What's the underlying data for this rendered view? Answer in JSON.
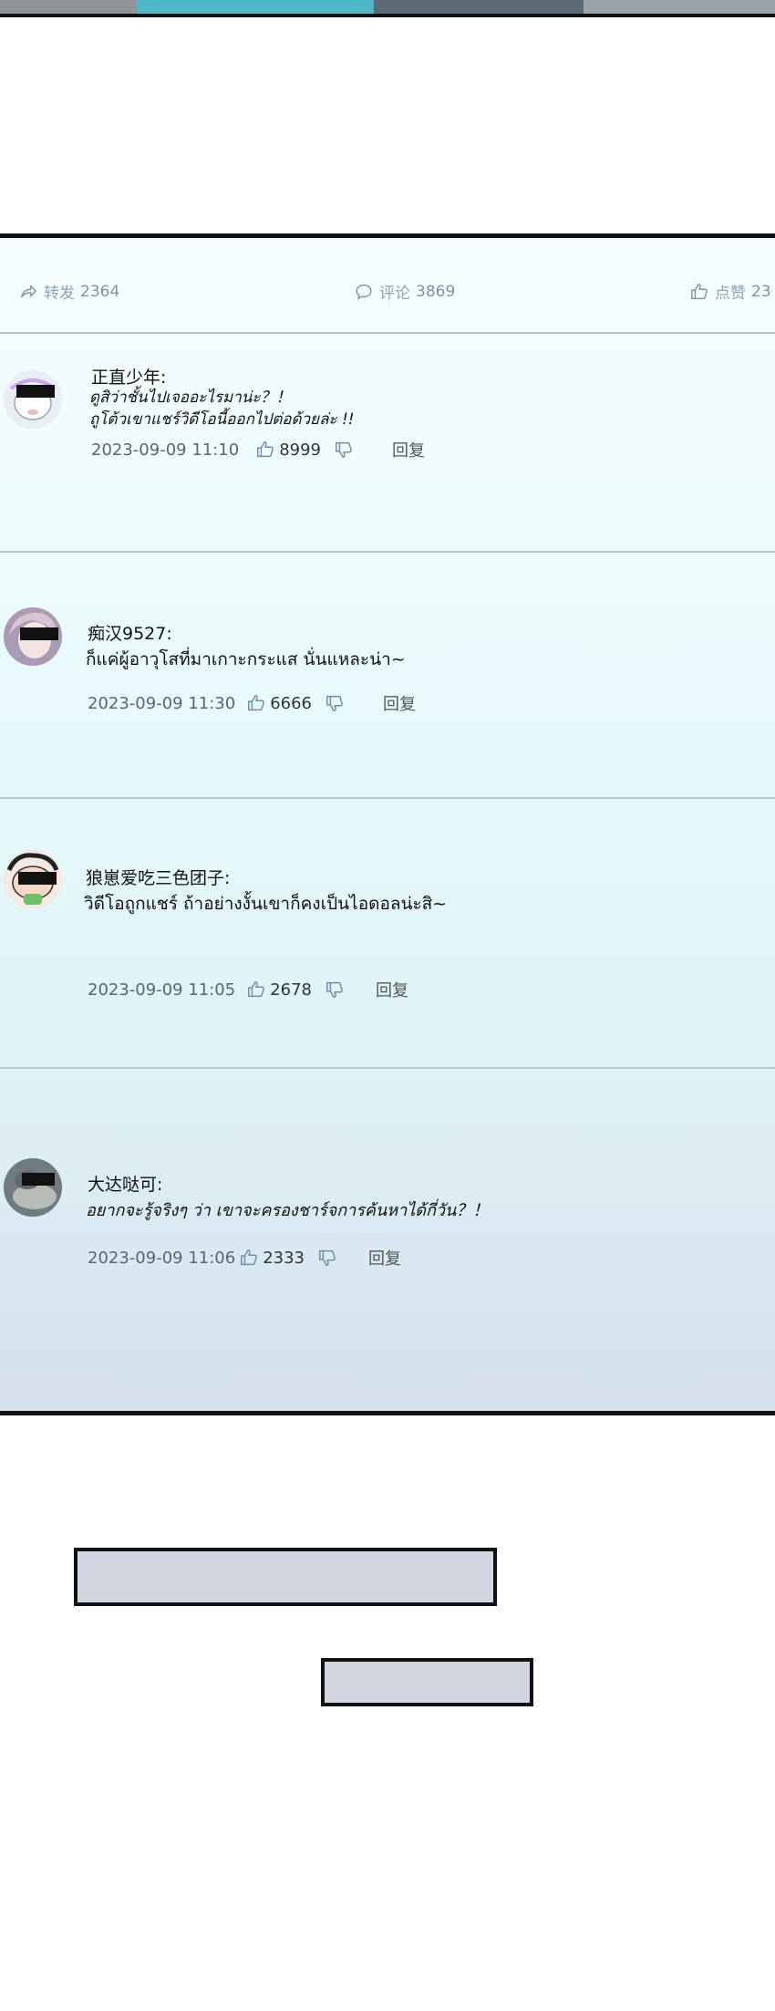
{
  "stats": {
    "share_label": "转发",
    "share_count": "2364",
    "comment_label": "评论",
    "comment_count": "3869",
    "like_label": "点赞",
    "like_count": "23"
  },
  "comments": [
    {
      "name": "正直少年:",
      "line1": "ดูสิว่าชั้นไปเจออะไรมาน่ะ？！",
      "line2": "ถูโต้วเขาแชร์วิดีโอนี้ออกไปต่อด้วยล่ะ !!",
      "date": "2023-09-09 11:10",
      "likes": "8999",
      "reply": "回复",
      "avatar_color": "#dde3ec"
    },
    {
      "name": "痴汉9527:",
      "line1": "ก็แค่ผู้อาวุโสที่มาเกาะกระแส นั่นแหละน่า~",
      "line2": "",
      "date": "2023-09-09   11:30",
      "likes": "6666",
      "reply": "回复",
      "avatar_color": "#b8a9c4"
    },
    {
      "name": "狼崽爱吃三色团子:",
      "line1": "วิดีโอถูกแชร์ ถ้าอย่างงั้นเขาก็คงเป็นไอดอลน่ะสิ~",
      "line2": "",
      "date": "2023-09-09   11:05",
      "likes": "2678",
      "reply": "回复",
      "avatar_color": "#e9c8c0"
    },
    {
      "name": "大达哒可:",
      "line1": "อยากจะรู้จริงๆ ว่า เขาจะครองชาร์จการค้นหาได้กี่วัน？！",
      "line2": "",
      "date": "2023-09-09   11:06",
      "likes": "2333",
      "reply": "回复",
      "avatar_color": "#7d8a8e"
    }
  ]
}
